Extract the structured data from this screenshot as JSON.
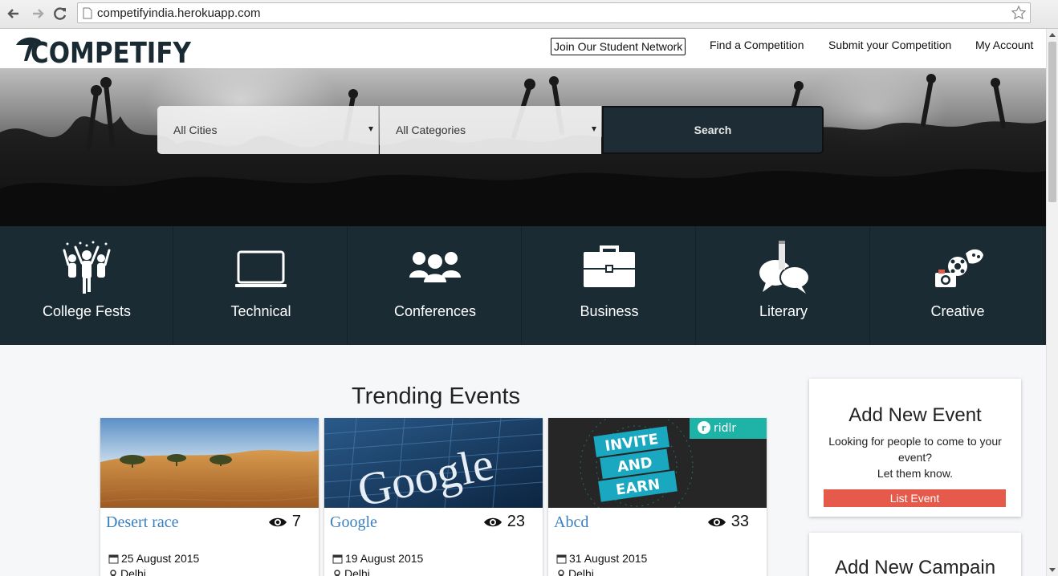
{
  "browser": {
    "url": "competifyindia.herokuapp.com"
  },
  "header": {
    "logo_text": "COMPETIFY",
    "nav": [
      {
        "label": "Join Our Student Network"
      },
      {
        "label": "Find a Competition"
      },
      {
        "label": "Submit your Competition"
      },
      {
        "label": "My Account"
      }
    ]
  },
  "search": {
    "city_value": "All Cities",
    "category_value": "All Categories",
    "button_label": "Search"
  },
  "categories": [
    {
      "label": "College Fests",
      "icon": "college-fests-icon"
    },
    {
      "label": "Technical",
      "icon": "laptop-icon"
    },
    {
      "label": "Conferences",
      "icon": "people-icon"
    },
    {
      "label": "Business",
      "icon": "briefcase-icon"
    },
    {
      "label": "Literary",
      "icon": "speech-bubbles-icon"
    },
    {
      "label": "Creative",
      "icon": "creative-icon"
    }
  ],
  "trending": {
    "title": "Trending Events",
    "events": [
      {
        "title": "Desert race",
        "views": "7",
        "date": "25 August 2015",
        "location": "Delhi"
      },
      {
        "title": "Google",
        "views": "23",
        "date": "19 August 2015",
        "location": "Delhi"
      },
      {
        "title": "Abcd",
        "views": "33",
        "date": "31 August 2015",
        "location": "Delhi"
      }
    ]
  },
  "thumbs": {
    "google_text": "Google",
    "ridlr_brand": "ridlr",
    "ridlr_banner": [
      "INVITE",
      "AND",
      "EARN"
    ]
  },
  "sidebar": {
    "add_event": {
      "title": "Add New Event",
      "line1": "Looking for people to come to your event?",
      "line2": "Let them know.",
      "button": "List Event"
    },
    "add_campaign": {
      "title": "Add New Campain"
    }
  },
  "colors": {
    "category_bar": "#1b2b34",
    "accent_button": "#e55a4a",
    "link": "#3a7fbf"
  }
}
